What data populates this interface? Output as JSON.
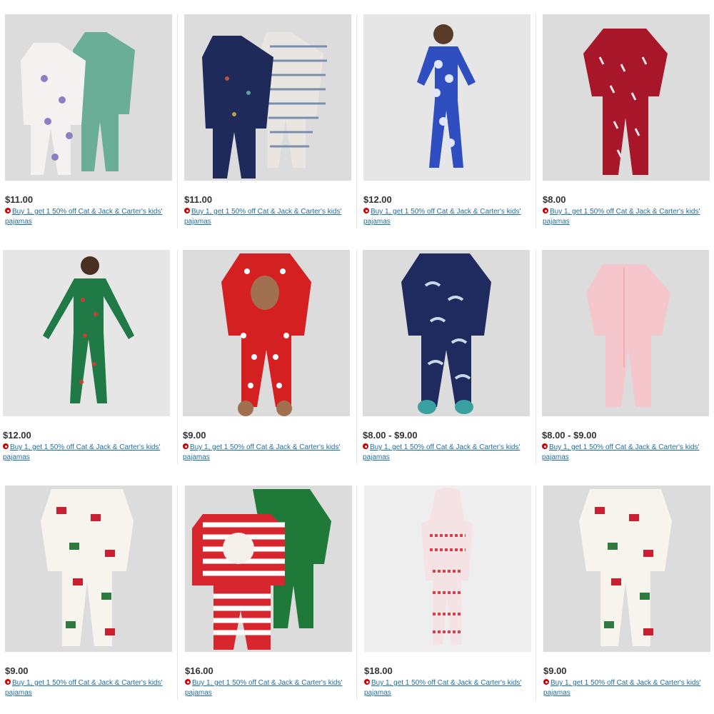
{
  "products": [
    {
      "price": "$11.00",
      "promo": "Buy 1, get 1 50% off Cat & Jack & Carter's kids' pajamas",
      "icon": "two-footed-sleepers-dinosaur-print"
    },
    {
      "price": "$11.00",
      "promo": "Buy 1, get 1 50% off Cat & Jack & Carter's kids' pajamas",
      "icon": "two-footed-sleepers-navy-striped"
    },
    {
      "price": "$12.00",
      "promo": "Buy 1, get 1 50% off Cat & Jack & Carter's kids' pajamas",
      "icon": "blue-snug-fit-pajama-set-model"
    },
    {
      "price": "$8.00",
      "promo": "Buy 1, get 1 50% off Cat & Jack & Carter's kids' pajamas",
      "icon": "red-candy-cane-footed-sleeper"
    },
    {
      "price": "$12.00",
      "promo": "Buy 1, get 1 50% off Cat & Jack & Carter's kids' pajamas",
      "icon": "green-holiday-pajama-set-model"
    },
    {
      "price": "$9.00",
      "promo": "Buy 1, get 1 50% off Cat & Jack & Carter's kids' pajamas",
      "icon": "red-polka-dot-reindeer-sleeper"
    },
    {
      "price": "$8.00 - $9.00",
      "promo": "Buy 1, get 1 50% off Cat & Jack & Carter's kids' pajamas",
      "icon": "navy-dinosaur-footed-sleeper"
    },
    {
      "price": "$8.00 - $9.00",
      "promo": "Buy 1, get 1 50% off Cat & Jack & Carter's kids' pajamas",
      "icon": "pink-footed-sleeper"
    },
    {
      "price": "$9.00",
      "promo": "Buy 1, get 1 50% off Cat & Jack & Carter's kids' pajamas",
      "icon": "santa-train-footed-sleeper"
    },
    {
      "price": "$16.00",
      "promo": "Buy 1, get 1 50% off Cat & Jack & Carter's kids' pajamas",
      "icon": "santa-stripe-pajama-set"
    },
    {
      "price": "$18.00",
      "promo": "Buy 1, get 1 50% off Cat & Jack & Carter's kids' pajamas",
      "icon": "fair-isle-hooded-union-suit"
    },
    {
      "price": "$9.00",
      "promo": "Buy 1, get 1 50% off Cat & Jack & Carter's kids' pajamas",
      "icon": "santa-train-footed-sleeper"
    }
  ],
  "colors": {
    "price": "#333333",
    "link": "#1f6f9e",
    "promo_dot": "#cc0000",
    "image_bg": "#dcdcdc"
  }
}
